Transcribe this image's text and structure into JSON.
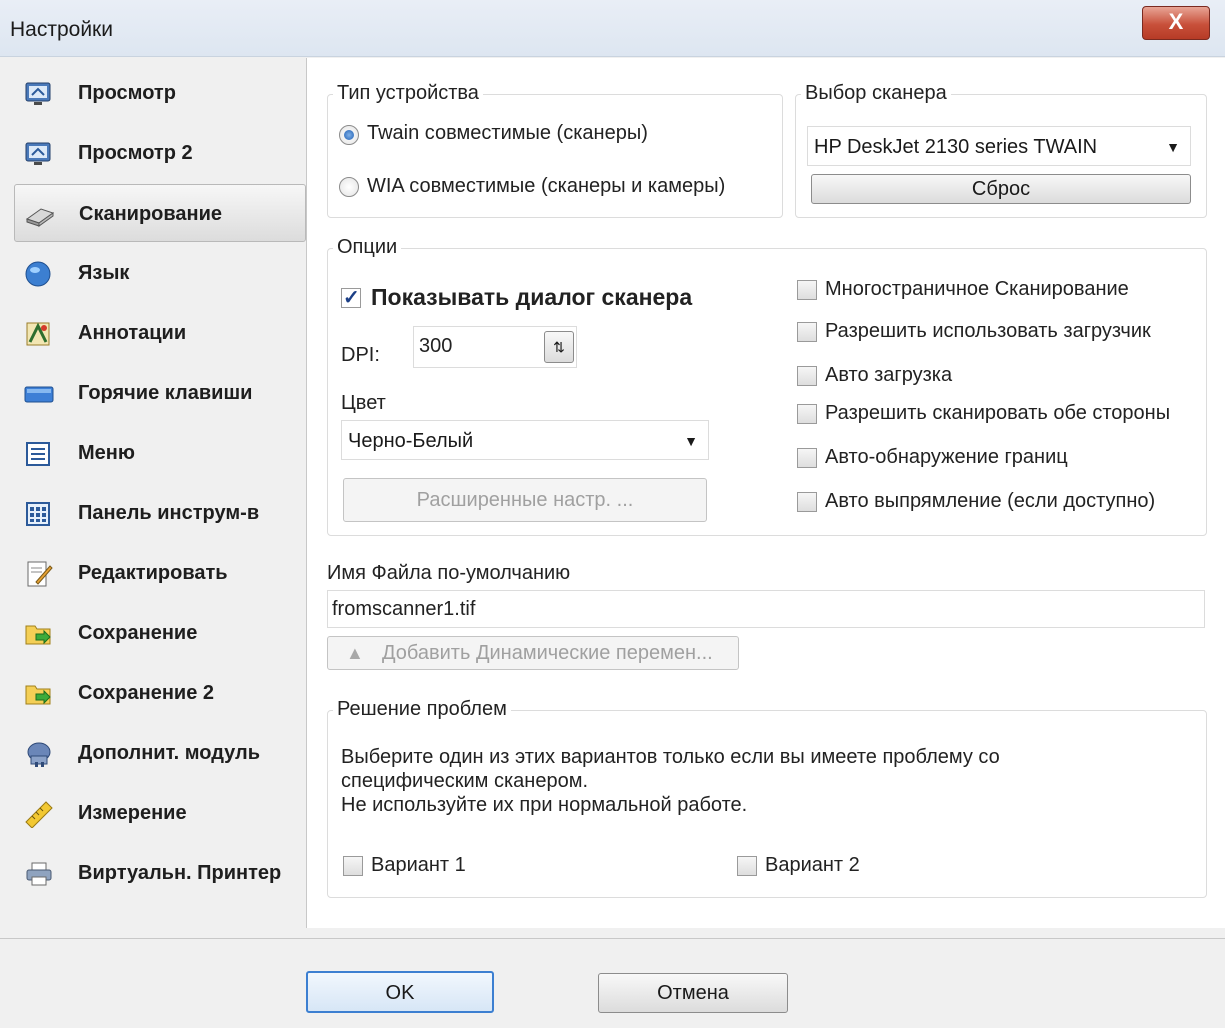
{
  "window": {
    "title": "Настройки",
    "close_glyph": "X"
  },
  "sidebar": {
    "items": [
      {
        "label": "Просмотр",
        "icon": "monitor-icon"
      },
      {
        "label": "Просмотр 2",
        "icon": "monitor-icon"
      },
      {
        "label": "Сканирование",
        "icon": "scanner-icon",
        "active": true
      },
      {
        "label": "Язык",
        "icon": "globe-icon"
      },
      {
        "label": "Аннотации",
        "icon": "annotation-icon"
      },
      {
        "label": "Горячие клавиши",
        "icon": "keyboard-icon"
      },
      {
        "label": "Меню",
        "icon": "menu-icon"
      },
      {
        "label": "Панель инструм-в",
        "icon": "toolbar-icon"
      },
      {
        "label": "Редактировать",
        "icon": "edit-icon"
      },
      {
        "label": "Сохранение",
        "icon": "save-folder-icon"
      },
      {
        "label": "Сохранение 2",
        "icon": "save-folder-icon"
      },
      {
        "label": "Дополнит. модуль",
        "icon": "plugin-icon"
      },
      {
        "label": "Измерение",
        "icon": "ruler-icon"
      },
      {
        "label": "Виртуальн. Принтер",
        "icon": "printer-icon"
      }
    ]
  },
  "device_type": {
    "title": "Тип устройства",
    "twain_label": "Twain совместимые (сканеры)",
    "twain_selected": true,
    "wia_label": "WIA совместимые (сканеры и камеры)",
    "wia_selected": false
  },
  "scanner_select": {
    "title": "Выбор сканера",
    "selected": "HP DeskJet 2130 series TWAIN",
    "reset_label": "Сброс"
  },
  "options": {
    "title": "Опции",
    "show_dialog_label": "Показывать диалог сканера",
    "show_dialog_checked": true,
    "dpi_label": "DPI:",
    "dpi_value": "300",
    "color_label": "Цвет",
    "color_value": "Черно-Белый",
    "advanced_label": "Расширенные настр. ...",
    "checkboxes": [
      {
        "label": "Многостраничное Сканирование",
        "checked": false
      },
      {
        "label": "Разрешить использовать загрузчик",
        "checked": false
      },
      {
        "label": "Авто загрузка",
        "checked": false
      },
      {
        "label": "Разрешить сканировать обе стороны",
        "checked": false
      },
      {
        "label": "Авто-обнаружение границ",
        "checked": false
      },
      {
        "label": "Авто выпрямление (если доступно)",
        "checked": false
      }
    ]
  },
  "filename": {
    "label": "Имя Файла по-умолчанию",
    "value": "fromscanner1.tif",
    "add_dynamic_label": "Добавить Динамические перемен..."
  },
  "troubleshoot": {
    "title": "Решение проблем",
    "line1": "Выберите один из этих вариантов только если вы имеете проблему со",
    "line2": "специфическим сканером.",
    "line3": "Не используйте их при нормальной работе.",
    "variant1_label": "Вариант 1",
    "variant1_checked": false,
    "variant2_label": "Вариант 2",
    "variant2_checked": false
  },
  "footer": {
    "ok_label": "OK",
    "cancel_label": "Отмена"
  }
}
